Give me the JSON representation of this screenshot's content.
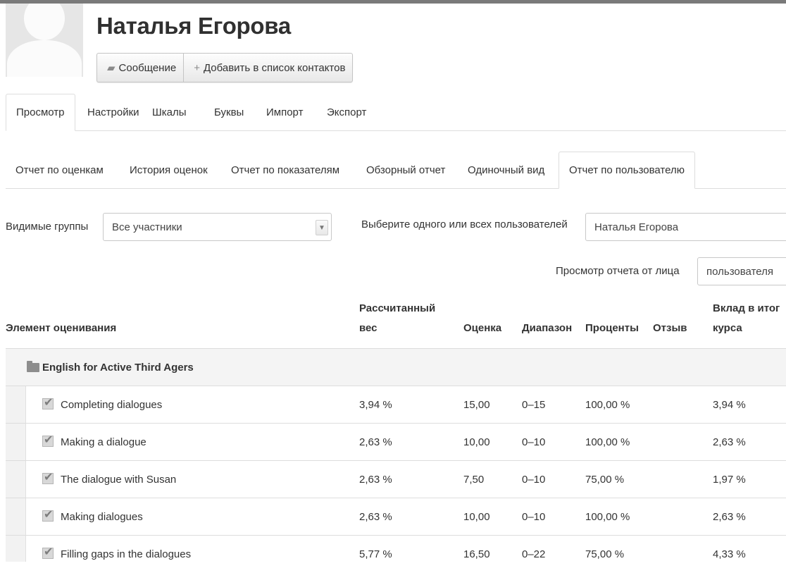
{
  "profile": {
    "name": "Наталья Егорова",
    "message_label": "Сообщение",
    "add_contact_label": "Добавить в список контактов"
  },
  "primary_tabs": [
    "Просмотр",
    "Настройки",
    "Шкалы",
    "Буквы",
    "Импорт",
    "Экспорт"
  ],
  "primary_active": "Просмотр",
  "secondary_tabs": [
    "Отчет по оценкам",
    "История оценок",
    "Отчет по показателям",
    "Обзорный отчет",
    "Одиночный вид",
    "Отчет по пользователю"
  ],
  "secondary_active": "Отчет по пользователю",
  "filters": {
    "groups_label": "Видимые группы",
    "groups_value": "Все участники",
    "user_label": "Выберите одного или всех пользователей",
    "user_value": "Наталья Егорова",
    "view_as_label": "Просмотр отчета от лица",
    "view_as_value": "пользователя"
  },
  "table": {
    "headers": {
      "item": "Элемент оценивания",
      "weight_line1": "Рассчитанный",
      "weight_line2": "вес",
      "grade": "Оценка",
      "range": "Диапазон",
      "percent": "Проценты",
      "feedback": "Отзыв",
      "contribution_line1": "Вклад в итог",
      "contribution_line2": "курса"
    },
    "category": "English for Active Third Agers",
    "rows": [
      {
        "item": "Completing dialogues",
        "weight": "3,94 %",
        "grade": "15,00",
        "range": "0–15",
        "percent": "100,00 %",
        "feedback": "",
        "contribution": "3,94 %"
      },
      {
        "item": "Making a dialogue",
        "weight": "2,63 %",
        "grade": "10,00",
        "range": "0–10",
        "percent": "100,00 %",
        "feedback": "",
        "contribution": "2,63 %"
      },
      {
        "item": "The dialogue with Susan",
        "weight": "2,63 %",
        "grade": "7,50",
        "range": "0–10",
        "percent": "75,00 %",
        "feedback": "",
        "contribution": "1,97 %"
      },
      {
        "item": "Making dialogues",
        "weight": "2,63 %",
        "grade": "10,00",
        "range": "0–10",
        "percent": "100,00 %",
        "feedback": "",
        "contribution": "2,63 %"
      },
      {
        "item": "Filling gaps in the dialogues",
        "weight": "5,77 %",
        "grade": "16,50",
        "range": "0–22",
        "percent": "75,00 %",
        "feedback": "",
        "contribution": "4,33 %"
      }
    ]
  }
}
